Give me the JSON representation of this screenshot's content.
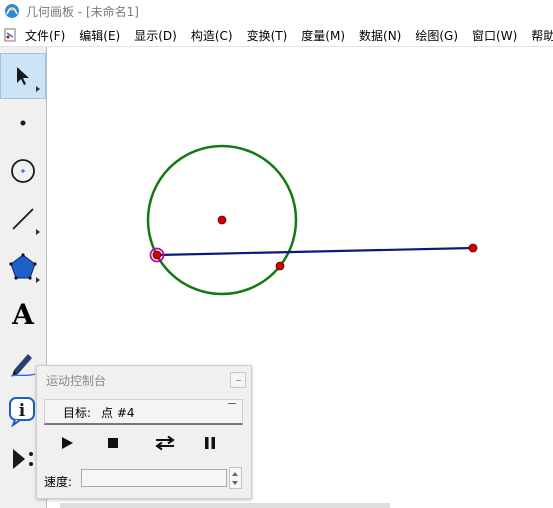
{
  "window": {
    "title": "几何画板 - [未命名1]"
  },
  "menu": {
    "items": [
      {
        "id": "file",
        "label": "文件(F)"
      },
      {
        "id": "edit",
        "label": "编辑(E)"
      },
      {
        "id": "display",
        "label": "显示(D)"
      },
      {
        "id": "construct",
        "label": "构造(C)"
      },
      {
        "id": "transform",
        "label": "变换(T)"
      },
      {
        "id": "measure",
        "label": "度量(M)"
      },
      {
        "id": "data",
        "label": "数据(N)"
      },
      {
        "id": "graph",
        "label": "绘图(G)"
      },
      {
        "id": "window",
        "label": "窗口(W)"
      },
      {
        "id": "help",
        "label": "帮助(H)"
      }
    ]
  },
  "toolbox": {
    "tools": [
      {
        "id": "arrow",
        "icon": "arrow-select-icon",
        "selected": true
      },
      {
        "id": "point",
        "icon": "point-tool-icon",
        "selected": false
      },
      {
        "id": "compass",
        "icon": "circle-tool-icon",
        "selected": false
      },
      {
        "id": "line",
        "icon": "line-tool-icon",
        "selected": false
      },
      {
        "id": "polygon",
        "icon": "polygon-tool-icon",
        "selected": false
      },
      {
        "id": "text",
        "icon": "text-tool-icon",
        "label": "A",
        "selected": false
      },
      {
        "id": "marker",
        "icon": "marker-tool-icon",
        "selected": false
      },
      {
        "id": "info",
        "icon": "info-tool-icon",
        "label": "i",
        "selected": false
      },
      {
        "id": "custom",
        "icon": "custom-tool-icon",
        "selected": false
      }
    ]
  },
  "colors": {
    "circle": "#137a13",
    "segment": "#0b1a7a",
    "point": "#d40000",
    "selected_point_ring": "#c000c0",
    "toolbox_bg": "#f0f0f0",
    "selected_tool_bg": "#cde3f6"
  },
  "motion_controller": {
    "title": "运动控制台",
    "target_label": "目标:",
    "target_value": "点 #4",
    "buttons": [
      {
        "id": "play",
        "icon": "play-icon"
      },
      {
        "id": "stop",
        "icon": "stop-icon"
      },
      {
        "id": "reverse",
        "icon": "reverse-direction-icon"
      },
      {
        "id": "pause",
        "icon": "pause-icon"
      }
    ],
    "speed_label": "速度:",
    "speed_value": ""
  }
}
